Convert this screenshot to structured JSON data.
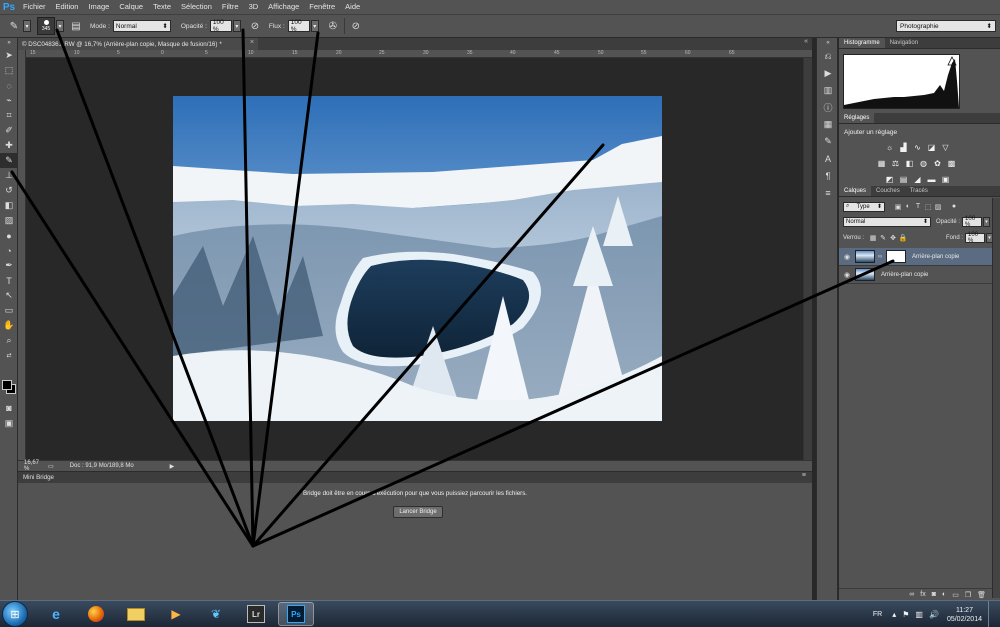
{
  "menubar": {
    "logo": "Ps",
    "items": [
      "Fichier",
      "Edition",
      "Image",
      "Calque",
      "Texte",
      "Sélection",
      "Filtre",
      "3D",
      "Affichage",
      "Fenêtre",
      "Aide"
    ]
  },
  "options": {
    "brush_size": "345",
    "mode_label": "Mode :",
    "mode_value": "Normal",
    "opacity_label": "Opacité :",
    "opacity_value": "100 %",
    "flow_label": "Flux :",
    "flow_value": "100 %",
    "workspace": "Photographie"
  },
  "document": {
    "tab_title": "© DSC04836.ARW @ 16,7% (Arrière-plan copie, Masque de fusion/16)",
    "tab_modified": "*",
    "zoom": "16,67 %",
    "doc_info": "Doc : 91,9 Mo/189,8 Mo",
    "ruler_marks": [
      "15",
      "10",
      "5",
      "0",
      "5",
      "10",
      "15",
      "20",
      "25",
      "30",
      "35",
      "40",
      "45",
      "50",
      "55",
      "60",
      "65"
    ]
  },
  "mini_bridge": {
    "title": "Mini Bridge",
    "message": "Bridge doit être en cours d'exécution pour que vous puissiez parcourir les fichiers.",
    "button_label": "Lancer Bridge"
  },
  "panels": {
    "top_tabs": [
      "Histogramme",
      "Navigation"
    ],
    "adjustments_tab": "Réglages",
    "adjustments_title": "Ajouter un réglage",
    "layers_tabs": [
      "Calques",
      "Couches",
      "Tracés"
    ],
    "filter_type": "Type",
    "blend_mode": "Normal",
    "opacity_label": "Opacité :",
    "opacity_value": "100 %",
    "lock_label": "Verrou :",
    "fill_label": "Fond :",
    "fill_value": "100 %",
    "layers": [
      {
        "name": "Arrière-plan copie",
        "selected": true,
        "has_mask": true
      },
      {
        "name": "Arrière-plan copie",
        "selected": false,
        "has_mask": false
      }
    ]
  },
  "taskbar": {
    "language": "FR",
    "time": "11:27",
    "date": "05/02/2014",
    "lr_label": "Lr",
    "ps_label": "Ps"
  },
  "colors": {
    "ui_panel": "#535353",
    "canvas_bg": "#282828",
    "accent_ps": "#31a8ff",
    "layer_selected": "#5b6c82"
  }
}
